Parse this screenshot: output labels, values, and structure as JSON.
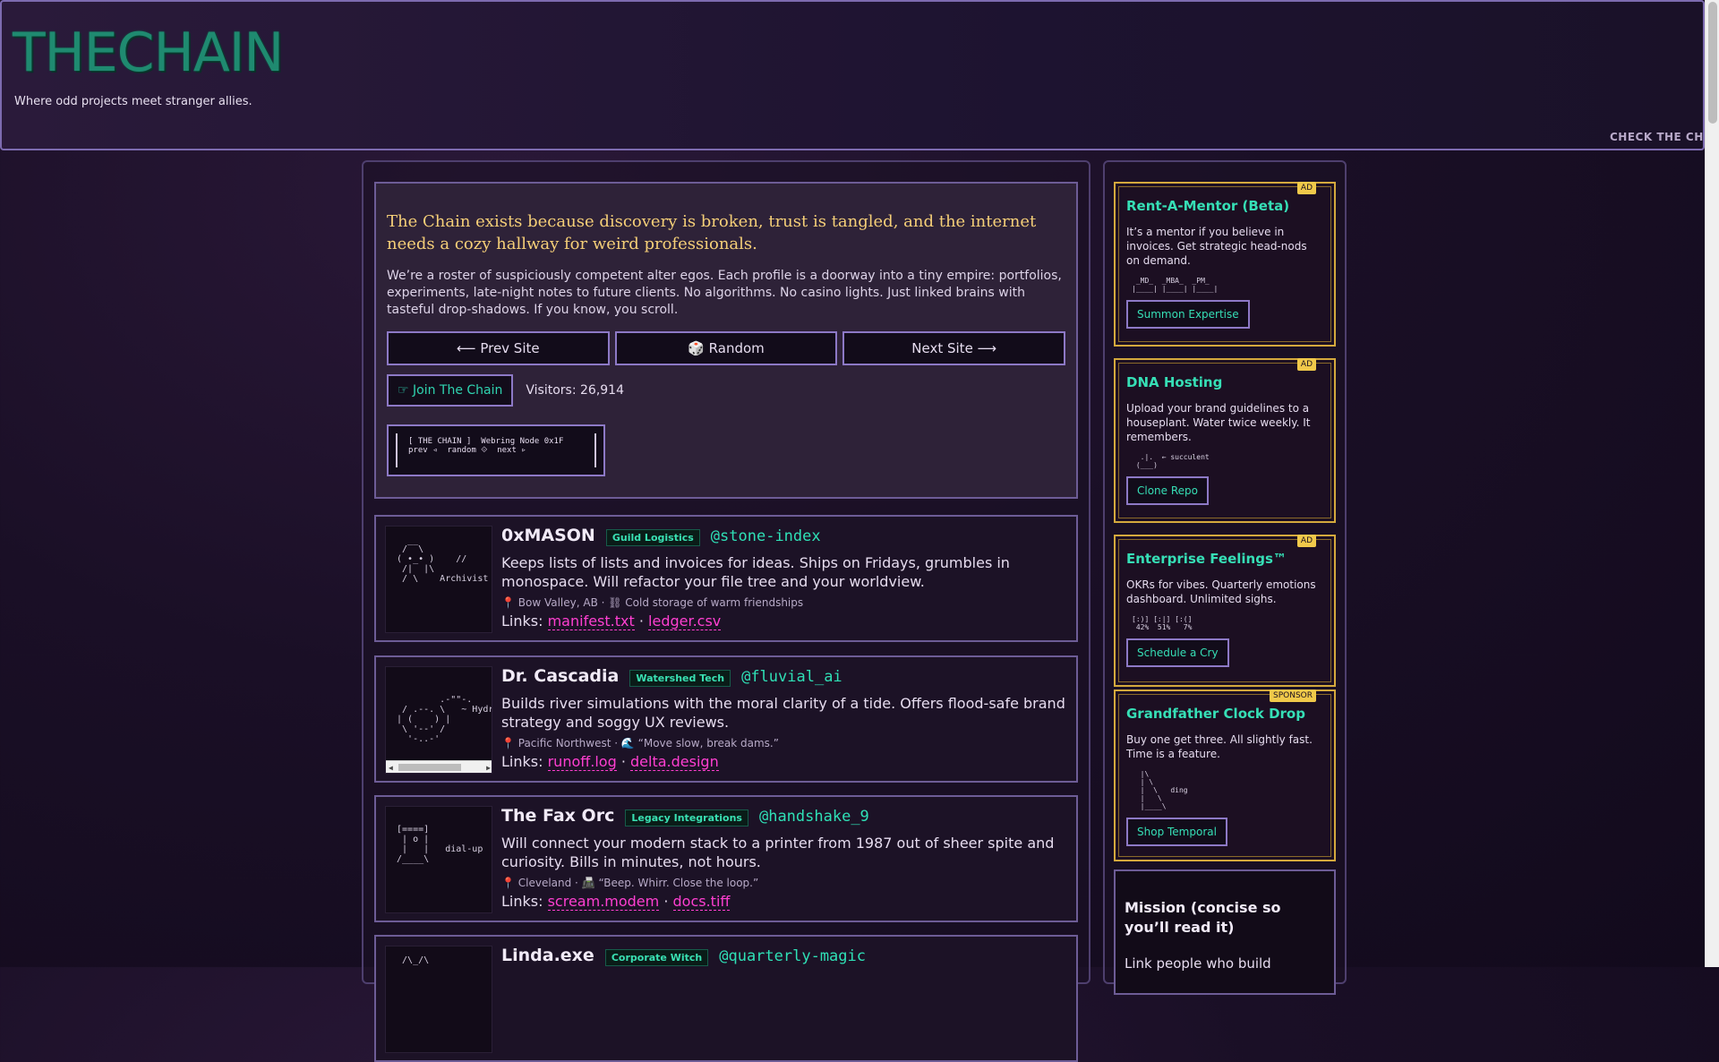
{
  "header": {
    "logo": "THECHAIN",
    "tagline": "Where odd projects meet stranger allies.",
    "marquee": "CHECK THE CHAIN"
  },
  "intro": {
    "lede": "The Chain exists because discovery is broken, trust is tangled, and the internet needs a cozy hallway for weird professionals.",
    "body": "We’re a roster of suspiciously competent alter egos. Each profile is a doorway into a tiny empire: portfolios, experiments, late-night notes to future clients. No algorithms. No casino lights. Just linked brains with tasteful drop-shadows. If you know, you scroll.",
    "prev_label": "⟵ Prev Site",
    "random_label": "🎲 Random",
    "next_label": "Next Site ⟶",
    "join_label": "☞ Join The Chain",
    "visitors": "Visitors: 26,914",
    "webring_art": "[ THE CHAIN ]  Webring Node 0x1F\nprev ◃  random ⟐  next ▹"
  },
  "members": [
    {
      "name": "0xMASON",
      "tag": "Guild Logistics",
      "handle": "@stone-index",
      "desc": "Keeps lists of lists and invoices for ideas. Ships on Fridays, grumbles in monospace. Will refactor your file tree and your worldview.",
      "meta": "📍 Bow Valley, AB · ⛓ Cold storage of warm friendships",
      "links_label": "Links:",
      "links": [
        "manifest.txt",
        "ledger.csv"
      ],
      "art": "  /‾‾\\\n ( •_• )    //\n  /|  |\\\n  / \\    Archivist"
    },
    {
      "name": "Dr. Cascadia",
      "tag": "Watershed Tech",
      "handle": "@fluvial_ai",
      "desc": "Builds river simulations with the moral clarity of a tide. Offers flood-safe brand strategy and soggy UX reviews.",
      "meta": "📍 Pacific Northwest · 🌊 “Move slow, break dams.”",
      "links_label": "Links:",
      "links": [
        "runoff.log",
        "delta.design"
      ],
      "art": "   .-\"\"-.\n  / .--. \\   ~ Hydro\n | (    ) |\n  \\ '--' /\n   '-..-'"
    },
    {
      "name": "The Fax Orc",
      "tag": "Legacy Integrations",
      "handle": "@handshake_9",
      "desc": "Will connect your modern stack to a printer from 1987 out of sheer spite and curiosity. Bills in minutes, not hours.",
      "meta": "📍 Cleveland · 📠 “Beep. Whirr. Close the loop.”",
      "links_label": "Links:",
      "links": [
        "scream.modem",
        "docs.tiff"
      ],
      "art": " [====]\n  | o |\n  |   |   dial-up\n /____\\"
    },
    {
      "name": "Linda.exe",
      "tag": "Corporate Witch",
      "handle": "@quarterly-magic",
      "desc": "",
      "meta": "",
      "links_label": "",
      "links": [],
      "art": "  /\\_/\\"
    }
  ],
  "ads": [
    {
      "label": "AD",
      "title": "Rent-A-Mentor (Beta)",
      "desc": "It’s a mentor if you believe in invoices. Get strategic head-nods on demand.",
      "art": " _MD_  _MBA_  _PM_\n|____| |____| |____|",
      "button": "Summon Expertise"
    },
    {
      "label": "AD",
      "title": "DNA Hosting",
      "desc": "Upload your brand guidelines to a houseplant. Water twice weekly. It remembers.",
      "art": "  .|.  ← succulent\n (___)",
      "button": "Clone Repo"
    },
    {
      "label": "AD",
      "title": "Enterprise Feelings™",
      "desc": "OKRs for vibes. Quarterly emotions dashboard. Unlimited sighs.",
      "art": "[:)] [:|] [:(]\n 42%  51%   7%",
      "button": "Schedule a Cry"
    },
    {
      "label": "SPONSOR",
      "title": "Grandfather Clock Drop",
      "desc": "Buy one get three. All slightly fast. Time is a feature.",
      "art": "  |\\\n  | \\\n  |  \\   ding\n  |   \\\n  |____\\",
      "button": "Shop Temporal"
    }
  ],
  "mission": {
    "title": "Mission (concise so you’ll read it)",
    "text": "Link people who build"
  }
}
